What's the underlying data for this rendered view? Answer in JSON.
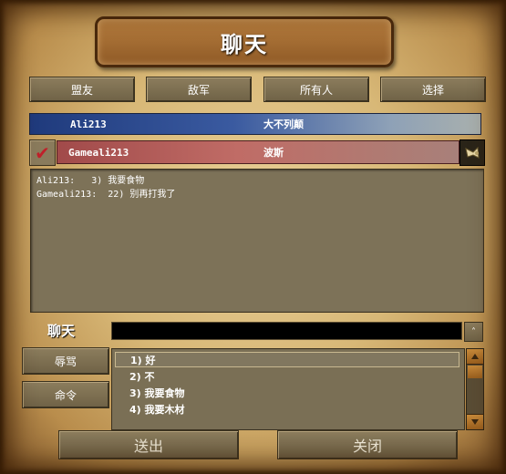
{
  "title": "聊天",
  "filter_buttons": [
    "盟友",
    "敌军",
    "所有人",
    "选择"
  ],
  "players": [
    {
      "name": "Ali213",
      "civ": "大不列颠",
      "color": "#2a4a8e"
    },
    {
      "name": "Gameali213",
      "civ": "波斯",
      "color": "#b35a55",
      "selected": true
    }
  ],
  "chat_log": [
    {
      "sender": "Ali213:",
      "message": "3) 我要食物"
    },
    {
      "sender": "Gameali213:",
      "message": "22) 别再打我了"
    }
  ],
  "chat_input": {
    "label": "聊天",
    "value": ""
  },
  "side_buttons": [
    "辱骂",
    "命令"
  ],
  "quick_messages": [
    "1) 好",
    "2) 不",
    "3) 我要食物",
    "4) 我要木材"
  ],
  "bottom_buttons": {
    "send": "送出",
    "close": "关闭"
  },
  "icons": {
    "check": "checkmark-icon",
    "horn": "horn-icon",
    "history": "caret-up-icon",
    "scroll_up": "arrow-up-icon",
    "scroll_down": "arrow-down-icon"
  }
}
